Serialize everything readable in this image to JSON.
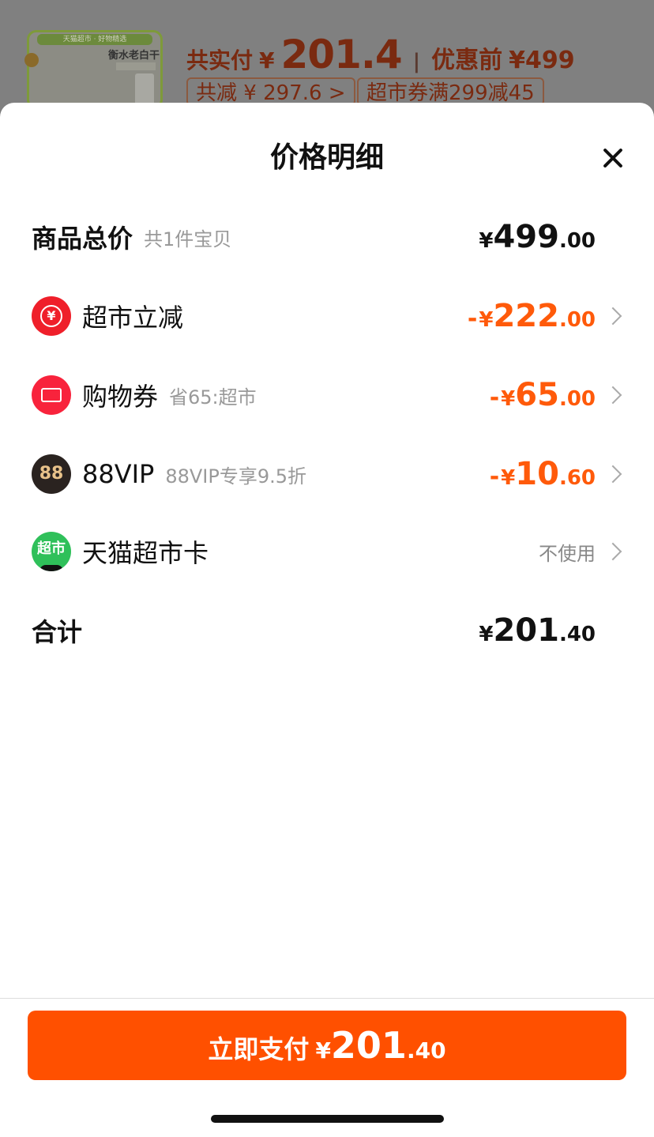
{
  "background": {
    "product_tag": "天猫超市 · 好物精选",
    "product_title": "衡水老白干",
    "paid_label": "共实付",
    "paid_currency": "¥",
    "paid_amount": "201.4",
    "divider": "|",
    "pre_discount_label": "优惠前",
    "pre_discount_amount": "¥499",
    "chip_total_saved": "共减 ¥ 297.6 >",
    "chip_coupon": "超市券满299减45"
  },
  "sheet": {
    "title": "价格明细",
    "rows": [
      {
        "label": "商品总价",
        "sub": "共1件宝贝",
        "currency": "¥",
        "int": "499",
        "dec": ".00"
      },
      {
        "label": "超市立减",
        "sub": "",
        "minus": "-",
        "currency": "¥",
        "int": "222",
        "dec": ".00",
        "icon_text": "¥"
      },
      {
        "label": "购物券",
        "sub": "省65:超市",
        "minus": "-",
        "currency": "¥",
        "int": "65",
        "dec": ".00"
      },
      {
        "label": "88VIP",
        "sub": "88VIP专享9.5折",
        "minus": "-",
        "currency": "¥",
        "int": "10",
        "dec": ".60",
        "icon_text": "88"
      },
      {
        "label": "天猫超市卡",
        "sub": "",
        "value_text": "不使用",
        "icon_text": "超市"
      },
      {
        "label": "合计",
        "sub": "",
        "currency": "¥",
        "int": "201",
        "dec": ".40"
      }
    ]
  },
  "pay_button": {
    "label": "立即支付",
    "currency": "¥",
    "int": "201",
    "dec": ".40"
  },
  "colors": {
    "accent": "#ff5000",
    "discount": "#ff5a0a"
  },
  "icons": [
    "close-icon",
    "rmb-rebate-icon",
    "ticket-icon",
    "vip88-icon",
    "supermarket-card-icon",
    "chevron-right-icon"
  ]
}
